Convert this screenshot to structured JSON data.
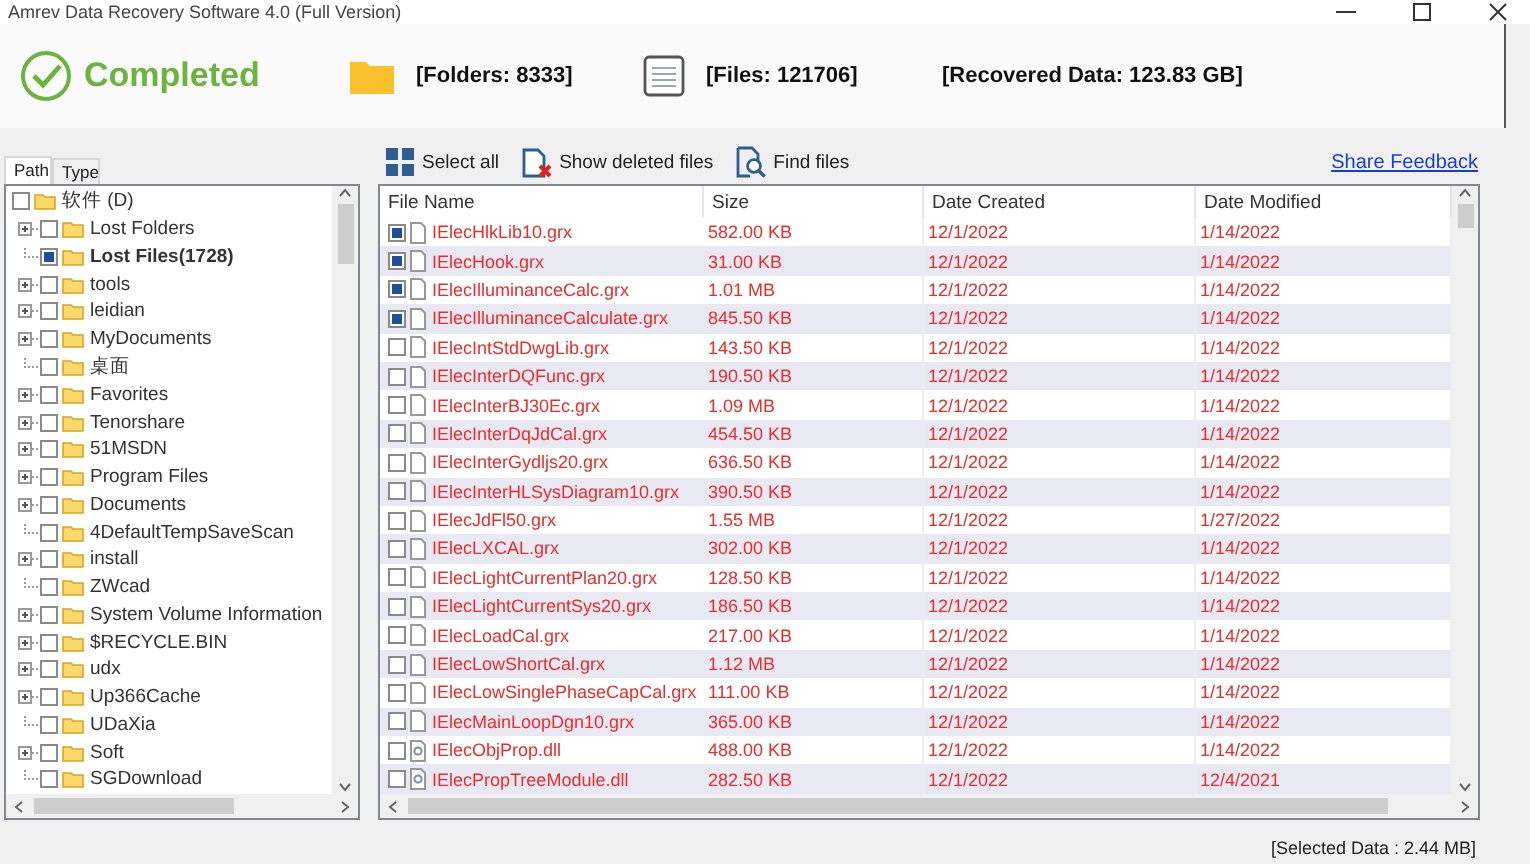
{
  "window": {
    "title": "Amrev Data Recovery Software 4.0 (Full Version)"
  },
  "summary": {
    "status": "Completed",
    "folders": "[Folders: 8333]",
    "files": "[Files: 121706]",
    "recovered": "[Recovered Data: 123.83 GB]"
  },
  "tabs": [
    {
      "label": "Path",
      "selected": true
    },
    {
      "label": "Type",
      "selected": false
    }
  ],
  "toolbar": {
    "buttons": [
      {
        "kind": "select_all",
        "label": "Select all"
      },
      {
        "kind": "show_deleted",
        "label": "Show deleted files"
      },
      {
        "kind": "find",
        "label": "Find files"
      }
    ],
    "link": "Share Feedback"
  },
  "tree": {
    "label": "软件 (D)",
    "checked": false,
    "children": [
      {
        "label": "Lost Folders",
        "checked": false,
        "expandable": true,
        "selected": false
      },
      {
        "label": "Lost Files(1728)",
        "checked": true,
        "expandable": false,
        "selected": true
      },
      {
        "label": "tools",
        "checked": false,
        "expandable": true,
        "selected": false
      },
      {
        "label": "leidian",
        "checked": false,
        "expandable": true,
        "selected": false
      },
      {
        "label": "MyDocuments",
        "checked": false,
        "expandable": true,
        "selected": false
      },
      {
        "label": "桌面",
        "checked": false,
        "expandable": false,
        "selected": false
      },
      {
        "label": "Favorites",
        "checked": false,
        "expandable": true,
        "selected": false
      },
      {
        "label": "Tenorshare",
        "checked": false,
        "expandable": true,
        "selected": false
      },
      {
        "label": "51MSDN",
        "checked": false,
        "expandable": true,
        "selected": false
      },
      {
        "label": "Program Files",
        "checked": false,
        "expandable": true,
        "selected": false
      },
      {
        "label": "Documents",
        "checked": false,
        "expandable": true,
        "selected": false
      },
      {
        "label": "4DefaultTempSaveScan",
        "checked": false,
        "expandable": false,
        "selected": false
      },
      {
        "label": "install",
        "checked": false,
        "expandable": true,
        "selected": false
      },
      {
        "label": "ZWcad",
        "checked": false,
        "expandable": false,
        "selected": false
      },
      {
        "label": "System Volume Information",
        "checked": false,
        "expandable": true,
        "selected": false
      },
      {
        "label": "$RECYCLE.BIN",
        "checked": false,
        "expandable": true,
        "selected": false
      },
      {
        "label": "udx",
        "checked": false,
        "expandable": true,
        "selected": false
      },
      {
        "label": "Up366Cache",
        "checked": false,
        "expandable": true,
        "selected": false
      },
      {
        "label": "UDaXia",
        "checked": false,
        "expandable": false,
        "selected": false
      },
      {
        "label": "Soft",
        "checked": false,
        "expandable": true,
        "selected": false
      },
      {
        "label": "SGDownload",
        "checked": false,
        "expandable": false,
        "selected": false
      }
    ]
  },
  "table": {
    "columns": [
      "File Name",
      "Size",
      "Date Created",
      "Date Modified"
    ],
    "rows": [
      {
        "name": "IElecHlkLib10.grx",
        "size": "582.00 KB",
        "created": "12/1/2022",
        "modified": "1/14/2022",
        "checked": true,
        "kind": "document"
      },
      {
        "name": "IElecHook.grx",
        "size": "31.00 KB",
        "created": "12/1/2022",
        "modified": "1/14/2022",
        "checked": true,
        "kind": "document"
      },
      {
        "name": "IElecIlluminanceCalc.grx",
        "size": "1.01 MB",
        "created": "12/1/2022",
        "modified": "1/14/2022",
        "checked": true,
        "kind": "document"
      },
      {
        "name": "IElecIlluminanceCalculate.grx",
        "size": "845.50 KB",
        "created": "12/1/2022",
        "modified": "1/14/2022",
        "checked": true,
        "kind": "document"
      },
      {
        "name": "IElecIntStdDwgLib.grx",
        "size": "143.50 KB",
        "created": "12/1/2022",
        "modified": "1/14/2022",
        "checked": false,
        "kind": "document"
      },
      {
        "name": "IElecInterDQFunc.grx",
        "size": "190.50 KB",
        "created": "12/1/2022",
        "modified": "1/14/2022",
        "checked": false,
        "kind": "document"
      },
      {
        "name": "IElecInterBJ30Ec.grx",
        "size": "1.09 MB",
        "created": "12/1/2022",
        "modified": "1/14/2022",
        "checked": false,
        "kind": "document"
      },
      {
        "name": "IElecInterDqJdCal.grx",
        "size": "454.50 KB",
        "created": "12/1/2022",
        "modified": "1/14/2022",
        "checked": false,
        "kind": "document"
      },
      {
        "name": "IElecInterGydljs20.grx",
        "size": "636.50 KB",
        "created": "12/1/2022",
        "modified": "1/14/2022",
        "checked": false,
        "kind": "document"
      },
      {
        "name": "IElecInterHLSysDiagram10.grx",
        "size": "390.50 KB",
        "created": "12/1/2022",
        "modified": "1/14/2022",
        "checked": false,
        "kind": "document"
      },
      {
        "name": "IElecJdFl50.grx",
        "size": "1.55 MB",
        "created": "12/1/2022",
        "modified": "1/27/2022",
        "checked": false,
        "kind": "document"
      },
      {
        "name": "IElecLXCAL.grx",
        "size": "302.00 KB",
        "created": "12/1/2022",
        "modified": "1/14/2022",
        "checked": false,
        "kind": "document"
      },
      {
        "name": "IElecLightCurrentPlan20.grx",
        "size": "128.50 KB",
        "created": "12/1/2022",
        "modified": "1/14/2022",
        "checked": false,
        "kind": "document"
      },
      {
        "name": "IElecLightCurrentSys20.grx",
        "size": "186.50 KB",
        "created": "12/1/2022",
        "modified": "1/14/2022",
        "checked": false,
        "kind": "document"
      },
      {
        "name": "IElecLoadCal.grx",
        "size": "217.00 KB",
        "created": "12/1/2022",
        "modified": "1/14/2022",
        "checked": false,
        "kind": "document"
      },
      {
        "name": "IElecLowShortCal.grx",
        "size": "1.12 MB",
        "created": "12/1/2022",
        "modified": "1/14/2022",
        "checked": false,
        "kind": "document"
      },
      {
        "name": "IElecLowSinglePhaseCapCal.grx",
        "size": "111.00 KB",
        "created": "12/1/2022",
        "modified": "1/14/2022",
        "checked": false,
        "kind": "document"
      },
      {
        "name": "IElecMainLoopDgn10.grx",
        "size": "365.00 KB",
        "created": "12/1/2022",
        "modified": "1/14/2022",
        "checked": false,
        "kind": "document"
      },
      {
        "name": "IElecObjProp.dll",
        "size": "488.00 KB",
        "created": "12/1/2022",
        "modified": "1/14/2022",
        "checked": false,
        "kind": "library"
      },
      {
        "name": "IElecPropTreeModule.dll",
        "size": "282.50 KB",
        "created": "12/1/2022",
        "modified": "12/4/2021",
        "checked": false,
        "kind": "library"
      }
    ]
  },
  "status_bar": {
    "selected_data": "[Selected Data : 2.44 MB]"
  }
}
